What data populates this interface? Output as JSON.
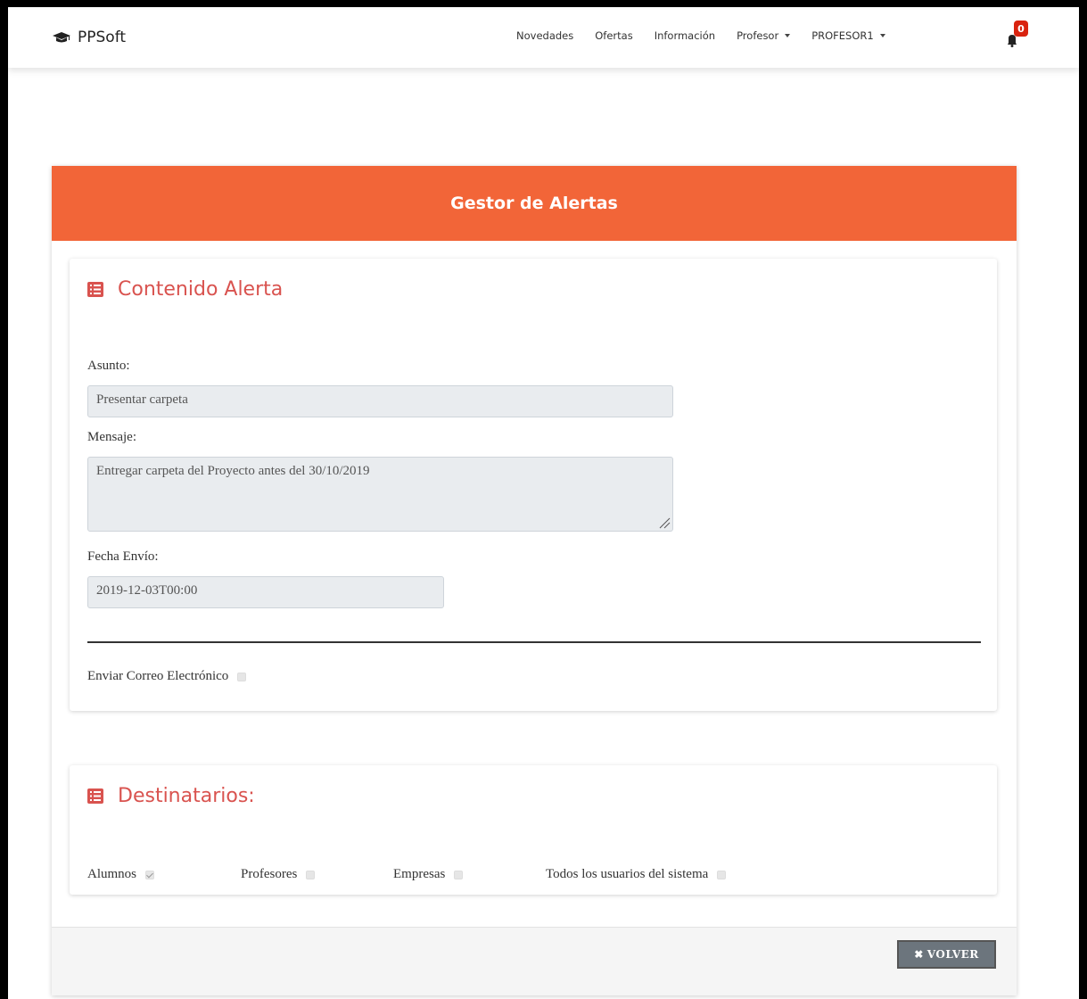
{
  "navbar": {
    "brand": "PPSoft",
    "items": [
      {
        "label": "Novedades",
        "dropdown": false
      },
      {
        "label": "Ofertas",
        "dropdown": false
      },
      {
        "label": "Información",
        "dropdown": false
      },
      {
        "label": "Profesor",
        "dropdown": true
      },
      {
        "label": "PROFESOR1",
        "dropdown": true
      }
    ],
    "notification_count": "0"
  },
  "card": {
    "title": "Gestor de Alertas",
    "accent_color": "#f26538"
  },
  "content_section": {
    "title": "Contenido Alerta",
    "asunto_label": "Asunto:",
    "asunto_value": "Presentar carpeta",
    "mensaje_label": "Mensaje:",
    "mensaje_value": "Entregar carpeta del Proyecto antes del 30/10/2019",
    "fecha_label": "Fecha Envío:",
    "fecha_value": "2019-12-03T00:00",
    "email_label": "Enviar Correo Electrónico",
    "email_checked": false
  },
  "recipients_section": {
    "title": "Destinatarios:",
    "options": [
      {
        "label": "Alumnos",
        "checked": true
      },
      {
        "label": "Profesores",
        "checked": false
      },
      {
        "label": "Empresas",
        "checked": false
      },
      {
        "label": "Todos los usuarios del sistema",
        "checked": false
      }
    ]
  },
  "footer": {
    "back_button": "VOLVER"
  }
}
